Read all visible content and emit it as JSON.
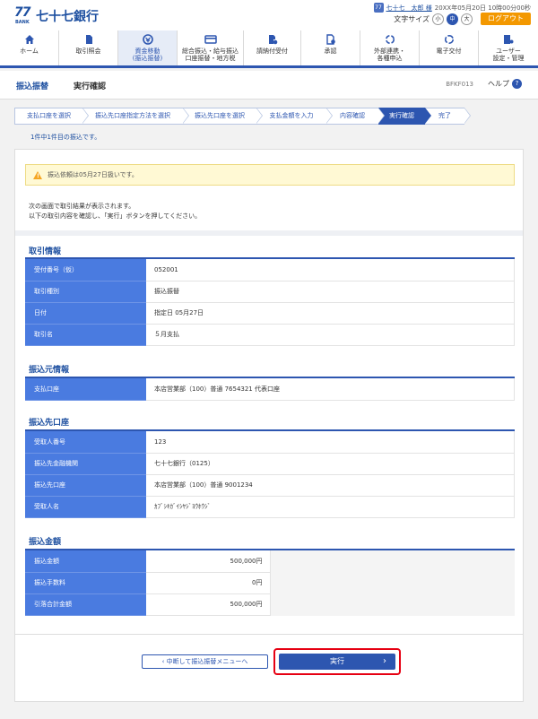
{
  "header": {
    "logo_number": "77",
    "logo_bank": "BANK",
    "bank_name": "七十七銀行",
    "user_icon": "user-badge-icon",
    "user_name": "七十七　太郎 様",
    "login_time": "20XX年05月20日 10時00分00秒",
    "font_size_label": "文字サイズ",
    "font_sizes": [
      "小",
      "中",
      "大"
    ],
    "font_size_selected": "中",
    "logout_label": "ログアウト"
  },
  "nav": {
    "items": [
      {
        "label": "ホーム",
        "icon": "home-icon",
        "active": false
      },
      {
        "label": "取引照会",
        "icon": "document-icon",
        "active": false
      },
      {
        "label": "資金移動\n(振込振替)",
        "icon": "transfer-icon",
        "active": true
      },
      {
        "label": "総合振込・給与振込\n口座振替・地方税",
        "icon": "card-icon",
        "active": false
      },
      {
        "label": "請納付受付",
        "icon": "payment-icon",
        "active": false
      },
      {
        "label": "承認",
        "icon": "approval-icon",
        "active": false
      },
      {
        "label": "外部連携・\n各種申込",
        "icon": "link-icon",
        "active": false
      },
      {
        "label": "電子交付",
        "icon": "delivery-icon",
        "active": false
      },
      {
        "label": "ユーザー\n設定・管理",
        "icon": "user-settings-icon",
        "active": false
      }
    ]
  },
  "titlebar": {
    "title": "振込振替",
    "subtitle": "実行確認",
    "screen_code": "BFKF013",
    "help_label": "ヘルプ",
    "help_icon": "?"
  },
  "steps": [
    {
      "label": "支払口座を選択",
      "active": false
    },
    {
      "label": "振込先口座指定方法を選択",
      "active": false
    },
    {
      "label": "振込先口座を選択",
      "active": false
    },
    {
      "label": "支払金額を入力",
      "active": false
    },
    {
      "label": "内容確認",
      "active": false
    },
    {
      "label": "実行確認",
      "active": true
    },
    {
      "label": "完了",
      "active": false
    }
  ],
  "count_text": "1件中1件目の振込です。",
  "notice": {
    "icon": "warning-icon",
    "text": "振込依頼は05月27日扱いです。"
  },
  "intro": {
    "line1": "次の画面で取引結果が表示されます。",
    "line2": "以下の取引内容を確認し、「実行」ボタンを押してください。"
  },
  "sections": {
    "transaction": {
      "title": "取引情報",
      "rows": [
        {
          "label": "受付番号（仮）",
          "value": "052001"
        },
        {
          "label": "取引種別",
          "value": "振込振替"
        },
        {
          "label": "日付",
          "value": "指定日 05月27日"
        },
        {
          "label": "取引名",
          "value": "５月支払"
        }
      ]
    },
    "source": {
      "title": "振込元情報",
      "rows": [
        {
          "label": "支払口座",
          "value": "本店営業部（100）普通 7654321 代表口座"
        }
      ]
    },
    "destination": {
      "title": "振込先口座",
      "rows": [
        {
          "label": "受取人番号",
          "value": "123"
        },
        {
          "label": "振込先金融機関",
          "value": "七十七銀行（0125）"
        },
        {
          "label": "振込先口座",
          "value": "本店営業部（100）普通 9001234"
        },
        {
          "label": "受取人名",
          "value": "ｶﾌﾞｼｷｶﾞｲｼﾔｼﾞﾖｳﾎｳｼﾞ"
        }
      ]
    },
    "amount": {
      "title": "振込金額",
      "rows": [
        {
          "label": "振込金額",
          "value": "500,000円"
        },
        {
          "label": "振込手数料",
          "value": "0円"
        },
        {
          "label": "引落合計金額",
          "value": "500,000円"
        }
      ]
    }
  },
  "buttons": {
    "back_label": "中断して振込振替メニューへ",
    "back_icon": "‹",
    "execute_label": "実行",
    "execute_icon": "›"
  },
  "colors": {
    "primary": "#2d56b0",
    "header_cell": "#4a7be0",
    "logout": "#f39800",
    "highlight": "#e60012",
    "notice_bg": "#fff9d4"
  }
}
